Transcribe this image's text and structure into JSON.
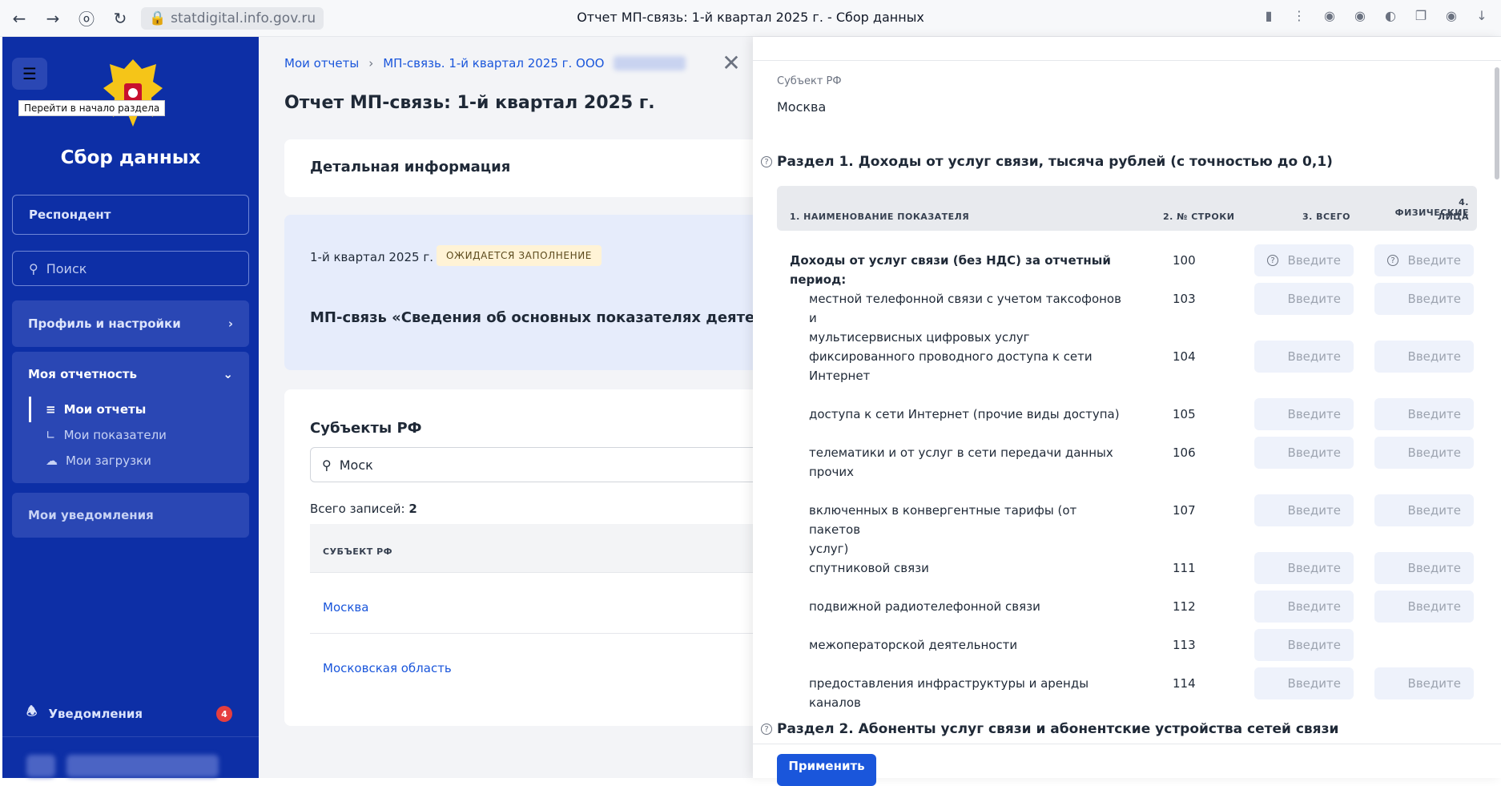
{
  "browser": {
    "url": "statdigital.info.gov.ru",
    "tab_title": "Отчет МП-связь: 1-й квартал 2025 г. - Сбор данных"
  },
  "sidebar": {
    "tooltip": "Перейти в начало раздела",
    "title": "Сбор данных",
    "respondent": "Респондент",
    "search_placeholder": "Поиск",
    "profile": "Профиль и настройки",
    "reports": "Моя отчетность",
    "items": [
      {
        "label": "Мои отчеты",
        "icon": "list-icon"
      },
      {
        "label": "Мои показатели",
        "icon": "chart-icon"
      },
      {
        "label": "Мои загрузки",
        "icon": "cloud-icon"
      }
    ],
    "notifications": "Мои уведомления",
    "bell_label": "Уведомления",
    "bell_count": "4"
  },
  "main": {
    "breadcrumb": [
      "Мои отчеты",
      "МП-связь. 1-й квартал 2025 г. ООО"
    ],
    "title": "Отчет МП-связь: 1-й квартал 2025 г.",
    "detail": "Детальная информация",
    "quarter": "1-й квартал 2025 г.",
    "status": "ОЖИДАЕТСЯ ЗАПОЛНЕНИЕ",
    "description": "МП-связь «Сведения об основных показателях деятельност",
    "subjects_title": "Субъекты РФ",
    "search_value": "Моск",
    "total_label": "Всего записей:",
    "total": "2",
    "col": "СУБЪЕКТ РФ",
    "rows": [
      "Москва",
      "Московская область"
    ]
  },
  "panel": {
    "subject_label": "Субъект РФ",
    "subject_value": "Москва",
    "section1": "Раздел 1. Доходы от услуг связи, тысяча рублей (с точностью до 0,1)",
    "section2": "Раздел 2. Абоненты услуг связи и абонентские устройства сетей связи",
    "headers": [
      "1. НАИМЕНОВАНИЕ ПОКАЗАТЕЛЯ",
      "2. № СТРОКИ",
      "3. ВСЕГО",
      "4. ФИЗИЧЕСКИЕ",
      "ЛИЦА"
    ],
    "placeholder": "Введите",
    "rows": [
      {
        "name": "Доходы от услуг связи (без НДС) за отчетный период:",
        "line1": "Доходы от услуг связи (без НДС) за отчетный период:",
        "line2": "",
        "num": "100"
      },
      {
        "line1": "местной телефонной связи с учетом таксофонов и",
        "line2": "мультисервисных цифровых услуг",
        "num": "103"
      },
      {
        "line1": "фиксированного проводного доступа к сети",
        "line2": "Интернет",
        "num": "104"
      },
      {
        "line1": "доступа к сети Интернет (прочие виды доступа)",
        "line2": "",
        "num": "105"
      },
      {
        "line1": "телематики и от услуг в сети передачи данных",
        "line2": "прочих",
        "num": "106"
      },
      {
        "line1": "включенных в конвергентные тарифы (от пакетов",
        "line2": "услуг)",
        "num": "107"
      },
      {
        "line1": "спутниковой связи",
        "line2": "",
        "num": "111"
      },
      {
        "line1": "подвижной радиотелефонной связи",
        "line2": "",
        "num": "112"
      },
      {
        "line1": "межоператорской деятельности",
        "line2": "",
        "num": "113"
      },
      {
        "line1": "предоставления инфраструктуры и аренды",
        "line2": "каналов",
        "num": "114"
      }
    ],
    "apply": "Применить"
  }
}
